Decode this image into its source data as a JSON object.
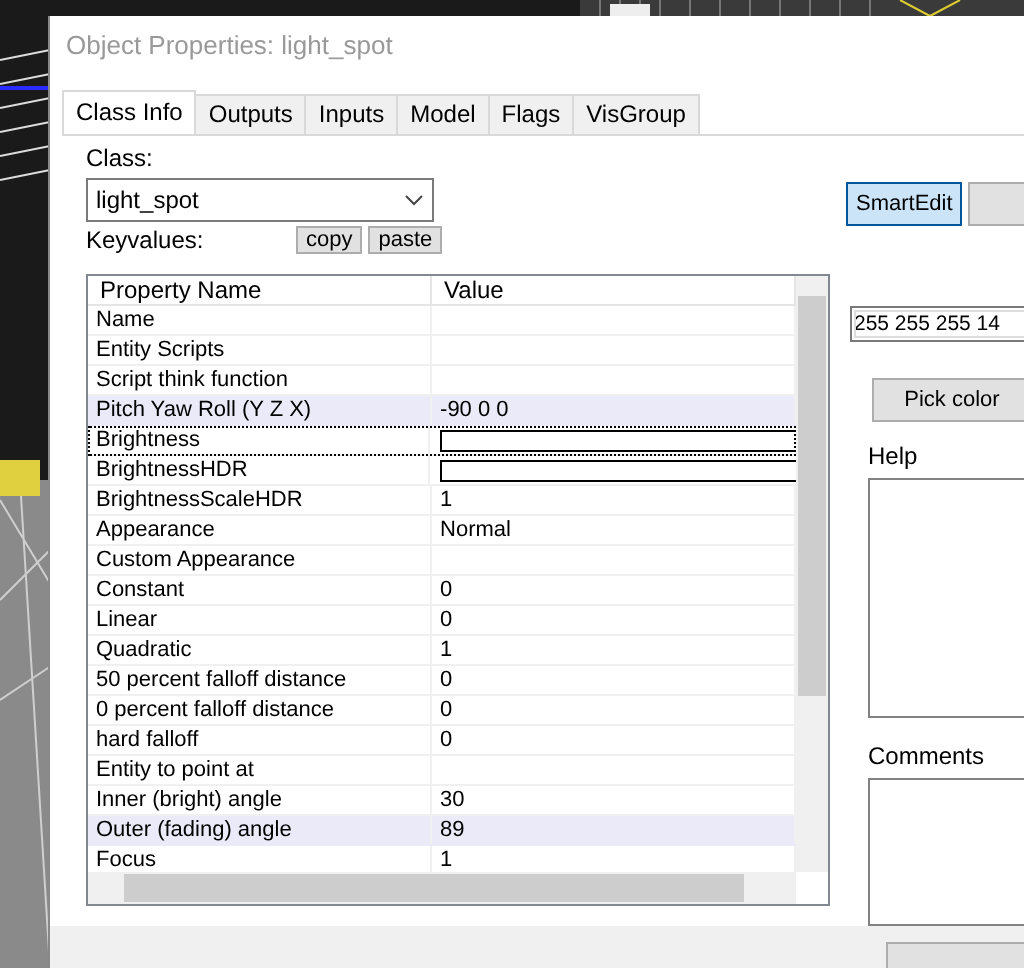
{
  "window": {
    "title": "Object Properties: light_spot"
  },
  "tabs": [
    {
      "label": "Class Info",
      "selected": true
    },
    {
      "label": "Outputs",
      "selected": false
    },
    {
      "label": "Inputs",
      "selected": false
    },
    {
      "label": "Model",
      "selected": false
    },
    {
      "label": "Flags",
      "selected": false
    },
    {
      "label": "VisGroup",
      "selected": false
    }
  ],
  "class_field": {
    "label": "Class:",
    "value": "light_spot"
  },
  "keyvalues": {
    "label": "Keyvalues:",
    "buttons": [
      "copy",
      "paste"
    ]
  },
  "smart_edit": {
    "label": "SmartEdit",
    "on": true
  },
  "table": {
    "columns": [
      "Property Name",
      "Value"
    ],
    "rows": [
      {
        "name": "Name",
        "value": "",
        "kind": "text",
        "highlighted": false,
        "focused": false
      },
      {
        "name": "Entity Scripts",
        "value": "",
        "kind": "text",
        "highlighted": false,
        "focused": false
      },
      {
        "name": "Script think function",
        "value": "",
        "kind": "text",
        "highlighted": false,
        "focused": false
      },
      {
        "name": "Pitch Yaw Roll (Y Z X)",
        "value": "-90 0 0",
        "kind": "text",
        "highlighted": true,
        "focused": false
      },
      {
        "name": "Brightness",
        "value": "",
        "kind": "field",
        "highlighted": false,
        "focused": true
      },
      {
        "name": "BrightnessHDR",
        "value": "",
        "kind": "field",
        "highlighted": false,
        "focused": false
      },
      {
        "name": "BrightnessScaleHDR",
        "value": "1",
        "kind": "text",
        "highlighted": false,
        "focused": false
      },
      {
        "name": "Appearance",
        "value": "Normal",
        "kind": "text",
        "highlighted": false,
        "focused": false
      },
      {
        "name": "Custom Appearance",
        "value": "",
        "kind": "text",
        "highlighted": false,
        "focused": false
      },
      {
        "name": "Constant",
        "value": "0",
        "kind": "text",
        "highlighted": false,
        "focused": false
      },
      {
        "name": "Linear",
        "value": "0",
        "kind": "text",
        "highlighted": false,
        "focused": false
      },
      {
        "name": "Quadratic",
        "value": "1",
        "kind": "text",
        "highlighted": false,
        "focused": false
      },
      {
        "name": "50 percent falloff distance",
        "value": "0",
        "kind": "text",
        "highlighted": false,
        "focused": false
      },
      {
        "name": "0 percent falloff distance",
        "value": "0",
        "kind": "text",
        "highlighted": false,
        "focused": false
      },
      {
        "name": "hard falloff",
        "value": "0",
        "kind": "text",
        "highlighted": false,
        "focused": false
      },
      {
        "name": "Entity to point at",
        "value": "",
        "kind": "text",
        "highlighted": false,
        "focused": false
      },
      {
        "name": "Inner (bright) angle",
        "value": "30",
        "kind": "text",
        "highlighted": false,
        "focused": false
      },
      {
        "name": "Outer (fading) angle",
        "value": "89",
        "kind": "text",
        "highlighted": true,
        "focused": false
      },
      {
        "name": "Focus",
        "value": "1",
        "kind": "text",
        "highlighted": false,
        "focused": false
      }
    ]
  },
  "value_field": {
    "value": "255 255 255 14"
  },
  "pick_color": {
    "label": "Pick color"
  },
  "help": {
    "label": "Help"
  },
  "comments": {
    "label": "Comments"
  }
}
